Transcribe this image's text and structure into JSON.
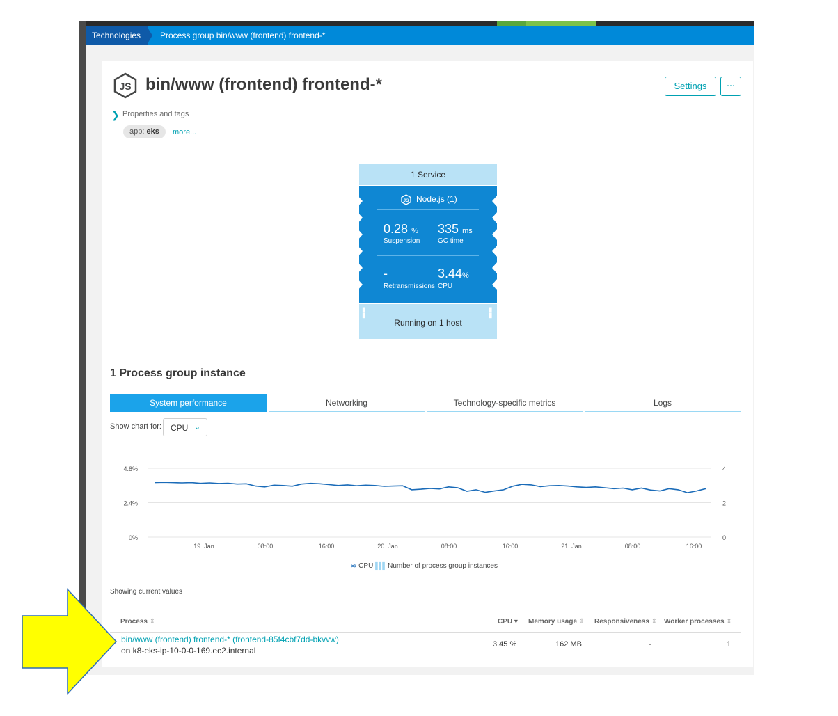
{
  "breadcrumb": {
    "root": "Technologies",
    "current": "Process group bin/www (frontend) frontend-*"
  },
  "header": {
    "title": "bin/www (frontend) frontend-*",
    "settings_label": "Settings",
    "more_label": "···",
    "icon": "nodejs-hex-icon"
  },
  "properties": {
    "label": "Properties and tags",
    "tag_key": "app:",
    "tag_value": "eks",
    "more_link": "more..."
  },
  "card": {
    "service": "1 Service",
    "tech_title": "Node.js (1)",
    "suspension_value": "0.28",
    "suspension_unit": "%",
    "suspension_label": "Suspension",
    "gc_value": "335",
    "gc_unit": "ms",
    "gc_label": "GC time",
    "retrans_value": "-",
    "retrans_label": "Retransmissions",
    "cpu_value": "3.44",
    "cpu_unit": "%",
    "cpu_label": "CPU",
    "host": "Running on 1 host"
  },
  "section": {
    "title": "1 Process group instance",
    "tabs": [
      "System performance",
      "Networking",
      "Technology-specific metrics",
      "Logs"
    ],
    "active_tab": "System performance",
    "show_chart_label": "Show chart for:",
    "chart_select": "CPU"
  },
  "chart_data": {
    "type": "line",
    "y_left_ticks": [
      "4.8%",
      "2.4%",
      "0%"
    ],
    "y_right_ticks": [
      "4",
      "2",
      "0"
    ],
    "ylim_left": [
      0,
      4.8
    ],
    "ylim_right": [
      0,
      4
    ],
    "x_ticks": [
      "19. Jan",
      "08:00",
      "16:00",
      "20. Jan",
      "08:00",
      "16:00",
      "21. Jan",
      "08:00",
      "16:00"
    ],
    "series": [
      {
        "name": "CPU",
        "type": "line",
        "values": [
          3.8,
          3.82,
          3.8,
          3.78,
          3.8,
          3.75,
          3.78,
          3.74,
          3.76,
          3.7,
          3.72,
          3.56,
          3.5,
          3.62,
          3.6,
          3.55,
          3.7,
          3.75,
          3.72,
          3.66,
          3.6,
          3.64,
          3.58,
          3.62,
          3.6,
          3.54,
          3.56,
          3.58,
          3.3,
          3.34,
          3.4,
          3.36,
          3.5,
          3.44,
          3.2,
          3.3,
          3.12,
          3.22,
          3.3,
          3.55,
          3.68,
          3.64,
          3.52,
          3.58,
          3.6,
          3.56,
          3.5,
          3.46,
          3.5,
          3.44,
          3.38,
          3.42,
          3.3,
          3.42,
          3.28,
          3.22,
          3.38,
          3.3,
          3.1,
          3.22,
          3.38
        ]
      },
      {
        "name": "Number of process group instances",
        "type": "bar",
        "constant_value": 1
      }
    ],
    "legend": [
      "CPU",
      "Number of process group instances"
    ],
    "legend_position": "bottom"
  },
  "table": {
    "showing_label": "Showing current values",
    "headers": [
      "Process",
      "CPU",
      "Memory usage",
      "Responsiveness",
      "Worker processes"
    ],
    "rows": [
      {
        "process": "bin/www (frontend) frontend-* (frontend-85f4cbf7dd-bkvvw)",
        "host": "on k8-eks-ip-10-0-0-169.ec2.internal",
        "cpu": "3.45 %",
        "memory": "162 MB",
        "responsiveness": "-",
        "workers": "1"
      }
    ]
  },
  "callout": {
    "color": "#ffff00",
    "stroke": "#2e6db4"
  }
}
